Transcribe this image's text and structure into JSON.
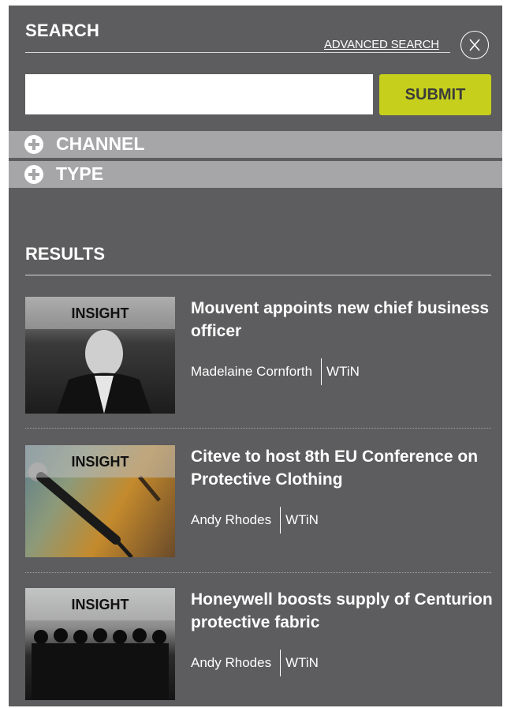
{
  "search": {
    "title": "SEARCH",
    "advanced_link": "ADVANCED SEARCH",
    "input_value": "",
    "input_placeholder": "",
    "submit_label": "SUBMIT",
    "close_icon": "circle-x-icon"
  },
  "filters": [
    {
      "label": "CHANNEL",
      "icon": "plus-circle-icon"
    },
    {
      "label": "TYPE",
      "icon": "plus-circle-icon"
    }
  ],
  "results": {
    "title": "RESULTS",
    "items": [
      {
        "tag": "INSIGHT",
        "title": "Mouvent appoints new chief business officer",
        "author": "Madelaine Cornforth",
        "source": "WTiN"
      },
      {
        "tag": "INSIGHT",
        "title": "Citeve to host 8th EU Conference on Protective Clothing",
        "author": "Andy Rhodes",
        "source": "WTiN"
      },
      {
        "tag": "INSIGHT",
        "title": "Honeywell boosts supply of Centurion protective fabric",
        "author": "Andy Rhodes",
        "source": "WTiN"
      }
    ]
  },
  "colors": {
    "panel_bg": "#5d5c5e",
    "filter_bar": "#a6a5a8",
    "submit_accent": "#c5cf1c"
  }
}
